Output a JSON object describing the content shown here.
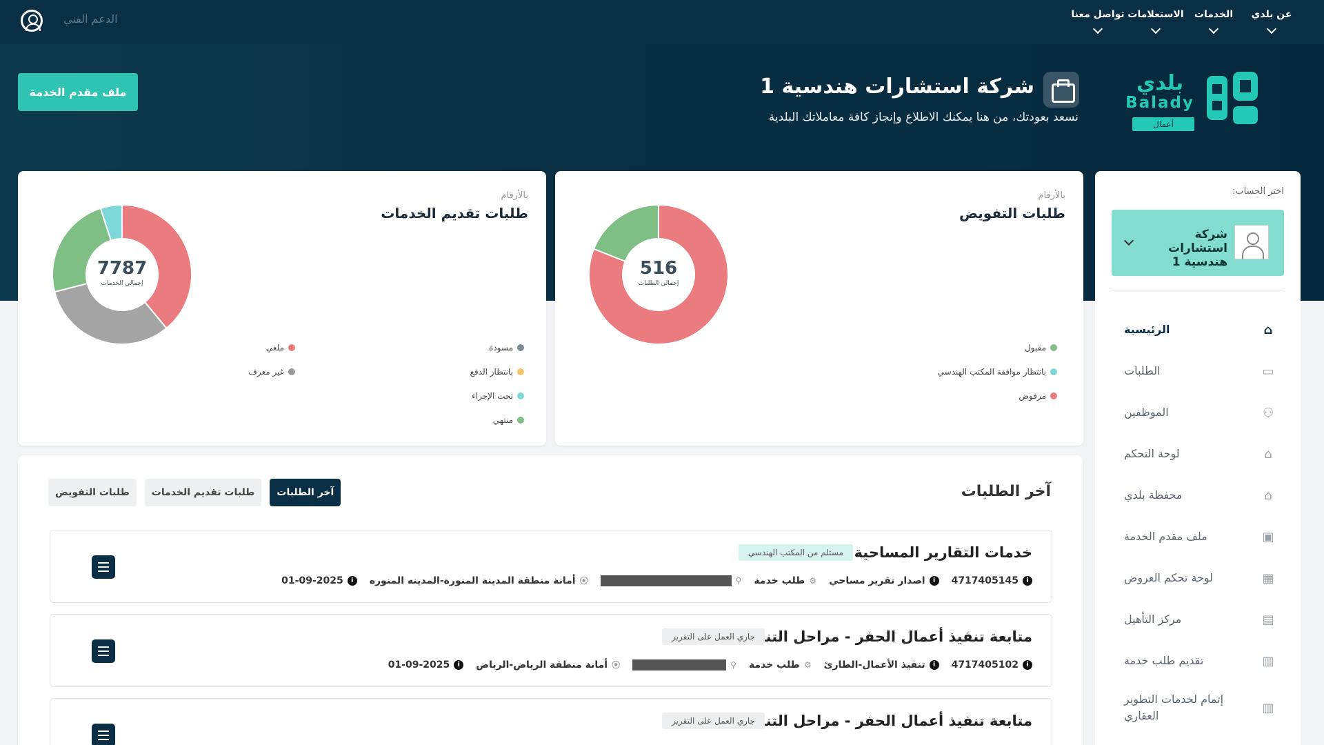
{
  "topbar": {
    "nav": [
      "عن بلدي",
      "الخدمات",
      "الاستعلامات",
      "تواصل معنا"
    ],
    "support": "الدعم الفني"
  },
  "logo": {
    "ar": "بلدي",
    "en": "Balady",
    "badge": "أعمال"
  },
  "hero": {
    "company": "شركة استشارات هندسية 1",
    "welcome": "نسعد بعودتك، من هنا يمكنك الاطلاع وإنجاز كافة معاملاتك البلدية",
    "profile_button": "ملف مقدم الخدمة"
  },
  "card_delegation": {
    "subtitle": "بالأرقام",
    "title": "طلبات التفويض",
    "total": "516",
    "total_label": "إجمالي الطلبات",
    "legend": [
      {
        "label": "مقبول",
        "color": "#7fbf86"
      },
      {
        "label": "بانتظار موافقة المكتب الهندسي",
        "color": "#7dd8d7"
      },
      {
        "label": "مرفوض",
        "color": "#ea7c80"
      }
    ]
  },
  "card_services": {
    "subtitle": "بالأرقام",
    "title": "طلبات تقديم الخدمات",
    "total": "7787",
    "total_label": "إجمالي الخدمات",
    "legend_right": [
      {
        "label": "مسودة",
        "color": "#7a8c9c"
      },
      {
        "label": "بانتظار الدفع",
        "color": "#f2c46c"
      },
      {
        "label": "تحت الإجراء",
        "color": "#7dd8d7"
      },
      {
        "label": "منتهي",
        "color": "#7fbf86"
      }
    ],
    "legend_left": [
      {
        "label": "ملغي",
        "color": "#ea7c80"
      },
      {
        "label": "غير معرف",
        "color": "#9b9b9b"
      }
    ]
  },
  "chart_data": [
    {
      "type": "pie",
      "title": "طلبات التفويض",
      "total": 516,
      "slices": [
        {
          "label": "مرفوض",
          "share": 0.81,
          "color": "#ea7c80"
        },
        {
          "label": "مقبول",
          "share": 0.19,
          "color": "#7fbf86"
        }
      ]
    },
    {
      "type": "pie",
      "title": "طلبات تقديم الخدمات",
      "total": 7787,
      "slices": [
        {
          "label": "ملغي",
          "share": 0.39,
          "color": "#ea7c80"
        },
        {
          "label": "غير معرف",
          "share": 0.32,
          "color": "#a4a4a4"
        },
        {
          "label": "منتهي",
          "share": 0.24,
          "color": "#7fbf86"
        },
        {
          "label": "تحت الإجراء",
          "share": 0.05,
          "color": "#7dd8d7"
        }
      ]
    }
  ],
  "sidebar": {
    "choose_label": "اختر الحساب:",
    "account": "شركة استشارات هندسية 1",
    "items": [
      {
        "label": "الرئيسية",
        "icon": "home-icon",
        "active": true
      },
      {
        "label": "الطلبات",
        "icon": "inbox-icon"
      },
      {
        "label": "الموظفين",
        "icon": "users-icon"
      },
      {
        "label": "لوحة التحكم",
        "icon": "dashboard-icon"
      },
      {
        "label": "محفظة بلدي",
        "icon": "wallet-icon"
      },
      {
        "label": "ملف مقدم الخدمة",
        "icon": "briefcase-icon"
      },
      {
        "label": "لوحة تحكم العروض",
        "icon": "offers-icon"
      },
      {
        "label": "مركز التأهيل",
        "icon": "table-icon"
      },
      {
        "label": "تقديم طلب خدمة",
        "icon": "request-icon"
      },
      {
        "label": "إتمام لخدمات التطوير العقاري",
        "icon": "building-icon"
      }
    ]
  },
  "latest": {
    "title": "آخر الطلبات",
    "tabs": [
      "آخر الطلبات",
      "طلبات تقديم الخدمات",
      "طلبات التفويض"
    ],
    "requests": [
      {
        "title": "خدمات التقارير المساحية",
        "status": "مستلم من المكتب الهندسي",
        "status_color": "#d7f3ef",
        "number": "4717405145",
        "service": "اصدار تقرير مساحي",
        "type": "طلب خدمة",
        "location": "أمانة منطقة المدينة المنورة-المدينه المنوره",
        "date": "01-09-2025"
      },
      {
        "title": "متابعة تنفيذ أعمال الحفر - مراحل التنفيذ",
        "status": "جاري العمل على التقرير",
        "status_color": "#eceef0",
        "number": "4717405102",
        "service": "تنفيذ الأعمال-الطارئ",
        "type": "طلب خدمة",
        "location": "أمانة منطقة الرياض-الرياض",
        "date": "01-09-2025"
      },
      {
        "title": "متابعة تنفيذ أعمال الحفر - مراحل التنفيذ",
        "status": "جاري العمل على التقرير",
        "status_color": "#eceef0"
      }
    ]
  }
}
